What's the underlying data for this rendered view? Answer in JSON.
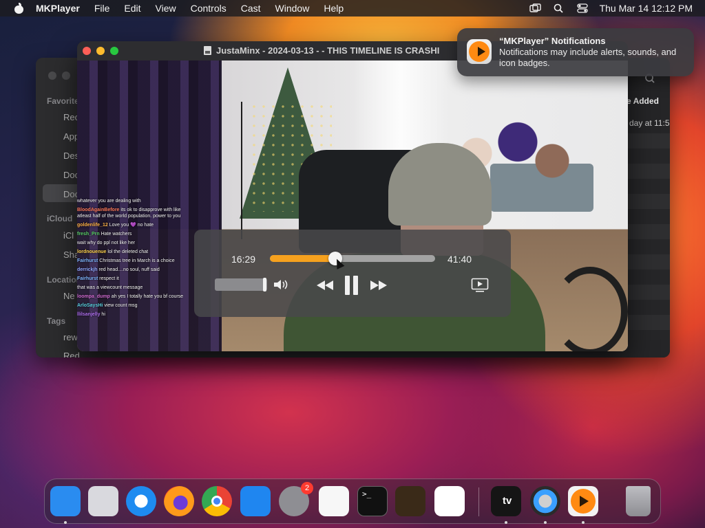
{
  "menubar": {
    "app_name": "MKPlayer",
    "items": [
      "File",
      "Edit",
      "View",
      "Controls",
      "Cast",
      "Window",
      "Help"
    ],
    "clock": "Thu Mar 14  12:12 PM",
    "icons": [
      "screen-mirroring-icon",
      "spotlight-search-icon",
      "control-center-icon"
    ]
  },
  "finder": {
    "sections": [
      "Favorites",
      "iCloud",
      "Locations",
      "Tags"
    ],
    "sidebar_items": [
      "Rec",
      "App",
      "Des",
      "Doc",
      "Doc",
      "iCl",
      "Sha",
      "Ne",
      "rew",
      "Red"
    ],
    "column_header": "e Added",
    "first_cell": "day at 11:5"
  },
  "player": {
    "title": "JustaMinx  - 2024-03-13 - - THIS TIMELINE IS CRASHI",
    "current_time": "16:29",
    "total_time": "41:40",
    "progress": 0.395,
    "volume": 0.95
  },
  "chat": [
    {
      "user": "",
      "text": "whatever you are dealing with",
      "color": "#ffffff"
    },
    {
      "user": "BloodAgainBefore",
      "text": "its ok to disapprove with like atleast half of the world population. power to you",
      "color": "#ff7b5c"
    },
    {
      "user": "goldenlife_12",
      "text": "Love you  💜 no hate",
      "color": "#ffb347"
    },
    {
      "user": "fresh_Prn",
      "text": "Hate watchers",
      "color": "#5bd16a"
    },
    {
      "user": "",
      "text": "wait why do ppl not like her",
      "color": "#7a5cff"
    },
    {
      "user": "lordnouenue",
      "text": "lol the deleted chat",
      "color": "#ffd34d"
    },
    {
      "user": "Fairhurst",
      "text": "Christmas tree in March is a choice",
      "color": "#7fb8ff"
    },
    {
      "user": "derrickjh",
      "text": "red head....no soul, nuff said",
      "color": "#8fa8ff"
    },
    {
      "user": "Fairhurst",
      "text": "respect it",
      "color": "#7fb8ff"
    },
    {
      "user": "",
      "text": "that was a viewcount message",
      "color": "#3fa04a"
    },
    {
      "user": "loompa_dump",
      "text": "ah yes I totally hate you bf course",
      "color": "#d06bd0"
    },
    {
      "user": "ArloSaysHi",
      "text": "view count msg",
      "color": "#5ad1e0"
    },
    {
      "user": "llilsanjelly",
      "text": "hi",
      "color": "#b070f0"
    }
  ],
  "notification": {
    "title": "“MKPlayer” Notifications",
    "body": "Notifications may include alerts, sounds, and icon badges."
  },
  "dock": {
    "apps": [
      {
        "name": "finder-icon",
        "color": "#2a8cf0"
      },
      {
        "name": "launchpad-icon",
        "color": "#d9d9de"
      },
      {
        "name": "safari-icon",
        "color": "#1e8bf0"
      },
      {
        "name": "firefox-icon",
        "color": "#ff7a1a"
      },
      {
        "name": "chrome-icon",
        "color": "#ffffff"
      },
      {
        "name": "app-store-icon",
        "color": "#1f86f0"
      },
      {
        "name": "system-settings-icon",
        "color": "#8e8e93",
        "badge": "2"
      },
      {
        "name": "textedit-icon",
        "color": "#f7f7f7"
      },
      {
        "name": "terminal-icon",
        "color": "#111111"
      },
      {
        "name": "garageband-icon",
        "color": "#3a2a18"
      },
      {
        "name": "vscode-icon",
        "color": "#ffffff"
      },
      {
        "name": "apple-tv-icon",
        "color": "#151515"
      },
      {
        "name": "quicktime-icon",
        "color": "#2b2b2b"
      },
      {
        "name": "mkplayer-icon",
        "color": "#f2f2f2"
      },
      {
        "name": "trash-icon",
        "color": "#9b9ba0"
      }
    ],
    "apple_tv_label": "tv",
    "terminal_label": ">_"
  }
}
